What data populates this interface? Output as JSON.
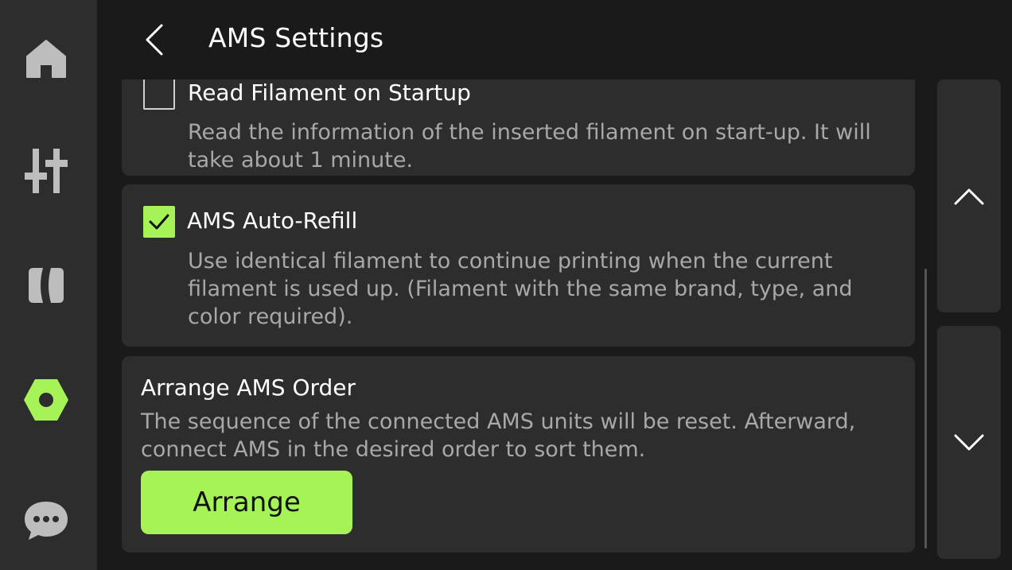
{
  "header": {
    "title": "AMS Settings"
  },
  "sidebar": {
    "items": [
      {
        "icon": "home-icon"
      },
      {
        "icon": "controls-icon"
      },
      {
        "icon": "filament-icon"
      },
      {
        "icon": "settings-icon",
        "active": true
      },
      {
        "icon": "chat-icon"
      }
    ]
  },
  "options": [
    {
      "title": "Read Filament on Startup",
      "description": "Read the information of the inserted filament on start-up. It will take about 1 minute.",
      "checked": false
    },
    {
      "title": "AMS Auto-Refill",
      "description": "Use identical filament to continue printing when the current filament is used up. (Filament with the same brand, type, and color required).",
      "checked": true
    }
  ],
  "arrange": {
    "title": "Arrange AMS Order",
    "description": "The sequence of the connected AMS units will be reset. Afterward, connect AMS in the desired order to sort them.",
    "button_label": "Arrange"
  },
  "colors": {
    "accent": "#a6f358",
    "panel": "#2d2d2d",
    "background": "#1a1a1a",
    "secondary_text": "#a8a8a8"
  }
}
